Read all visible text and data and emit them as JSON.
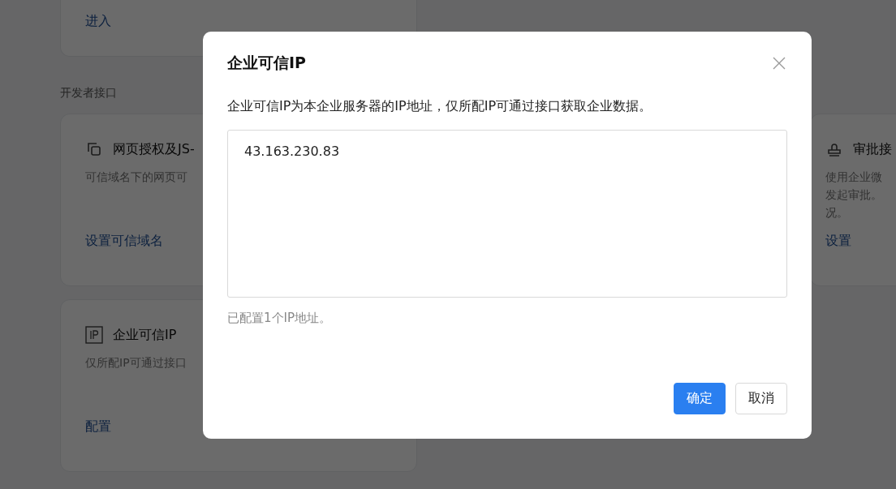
{
  "background": {
    "top_card": {
      "link": "进入"
    },
    "section_label": "开发者接口",
    "cards": [
      {
        "title": "网页授权及JS-",
        "lines": [
          "可信域名下的网页可"
        ],
        "link": "设置可信域名"
      },
      {
        "title": "审批接",
        "lines": [
          "使用企业微",
          "发起审批。",
          "况。"
        ],
        "link": "设置"
      },
      {
        "title": "企业可信IP",
        "lines": [
          "仅所配IP可通过接口"
        ],
        "link": "配置"
      }
    ]
  },
  "dialog": {
    "title": "企业可信IP",
    "description": "企业可信IP为本企业服务器的IP地址，仅所配IP可通过接口获取企业数据。",
    "ip_list": {
      "value": "43.163.230.83"
    },
    "count_note": "已配置1个IP地址。",
    "buttons": [
      {
        "label": "确定",
        "kind": "primary"
      },
      {
        "label": "取消",
        "kind": "default"
      }
    ]
  }
}
